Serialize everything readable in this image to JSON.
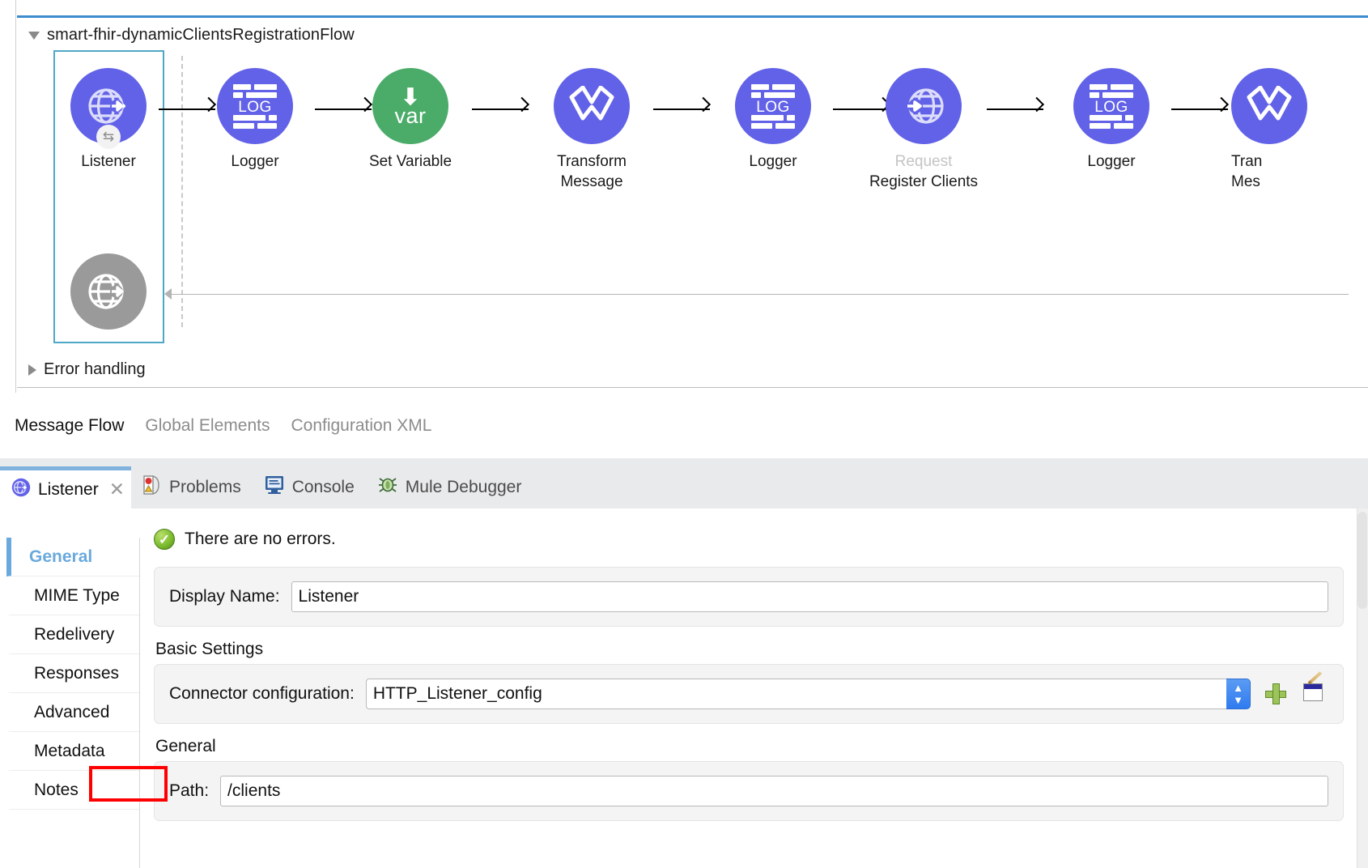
{
  "canvas": {
    "flow_name": "smart-fhir-dynamicClientsRegistrationFlow",
    "error_handling_label": "Error handling",
    "expand_icon": "triangle-down-icon",
    "collapse_icon": "triangle-right-icon",
    "nodes": [
      {
        "id": "listener",
        "label": "Listener",
        "sublabel": "",
        "icon": "globe-arrow-icon",
        "color": "#6262e8",
        "style": "purple",
        "glyph": "globe",
        "badge": "sync-badge"
      },
      {
        "id": "logger1",
        "label": "Logger",
        "sublabel": "",
        "icon": "log-icon",
        "color": "#6262e8",
        "style": "purple",
        "glyph": "log"
      },
      {
        "id": "setvar",
        "label": "Set Variable",
        "sublabel": "",
        "icon": "set-variable-icon",
        "color": "#4aac68",
        "style": "green",
        "glyph": "var"
      },
      {
        "id": "transform1",
        "label": "Transform",
        "sublabel": "Message",
        "icon": "transform-message-icon",
        "color": "#6262e8",
        "style": "purple",
        "glyph": "transform"
      },
      {
        "id": "logger2",
        "label": "Logger",
        "sublabel": "",
        "icon": "log-icon",
        "color": "#6262e8",
        "style": "purple",
        "glyph": "log"
      },
      {
        "id": "request",
        "label": "Request",
        "sublabel": "Register Clients",
        "icon": "http-request-icon",
        "color": "#6262e8",
        "style": "purple",
        "glyph": "globe-in",
        "label_muted": true
      },
      {
        "id": "logger3",
        "label": "Logger",
        "sublabel": "",
        "icon": "log-icon",
        "color": "#6262e8",
        "style": "purple",
        "glyph": "log"
      },
      {
        "id": "transform2",
        "label": "Tran",
        "sublabel": "Mes",
        "icon": "transform-message-icon",
        "color": "#6262e8",
        "style": "purple",
        "glyph": "transform"
      }
    ],
    "response_node": {
      "id": "listener-response",
      "icon": "globe-arrow-icon",
      "color": "#9a9a9a"
    },
    "var_glyph_text": "var",
    "log_glyph_text": "LOG"
  },
  "view_tabs": [
    {
      "label": "Message Flow",
      "active": true
    },
    {
      "label": "Global Elements",
      "active": false
    },
    {
      "label": "Configuration XML",
      "active": false
    }
  ],
  "panel_tabs": [
    {
      "label": "Listener",
      "icon": "globe-arrow-icon",
      "active": true,
      "closable": true,
      "close_glyph": "✕"
    },
    {
      "label": "Problems",
      "icon": "problems-icon",
      "active": false
    },
    {
      "label": "Console",
      "icon": "console-icon",
      "active": false
    },
    {
      "label": "Mule Debugger",
      "icon": "bug-icon",
      "active": false
    }
  ],
  "panel_nav": [
    {
      "label": "General",
      "active": true
    },
    {
      "label": "MIME Type",
      "active": false
    },
    {
      "label": "Redelivery",
      "active": false
    },
    {
      "label": "Responses",
      "active": false
    },
    {
      "label": "Advanced",
      "active": false
    },
    {
      "label": "Metadata",
      "active": false
    },
    {
      "label": "Notes",
      "active": false
    }
  ],
  "form": {
    "status_text": "There are no errors.",
    "status_icon": "success-check-icon",
    "display_name_label": "Display Name:",
    "display_name_value": "Listener",
    "basic_settings_title": "Basic Settings",
    "connector_label": "Connector configuration:",
    "connector_value": "HTTP_Listener_config",
    "dropdown_icon": "spinner-chevrons-icon",
    "add_button_icon": "green-plus-icon",
    "edit_button_icon": "edit-pencil-icon",
    "general_title": "General",
    "path_label": "Path:",
    "path_value": "/clients"
  },
  "colors": {
    "node_purple": "#6262e8",
    "node_green": "#4aac68",
    "node_gray": "#9a9a9a",
    "selection_border": "#4fa8c5",
    "flow_top_border": "#3d8bcd",
    "active_tab_accent": "#7fb2dc",
    "nav_active": "#6aa9dd",
    "annotation_red": "#ff0000"
  }
}
